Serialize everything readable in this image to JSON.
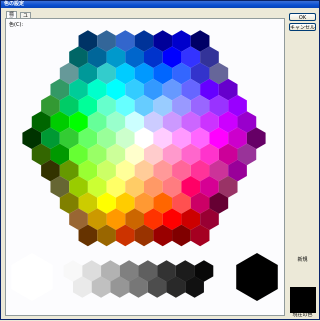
{
  "window": {
    "title": "色の設定"
  },
  "tabs": [
    {
      "label": "標準",
      "active": true
    },
    {
      "label": "ユーザー設定",
      "active": false
    }
  ],
  "panel": {
    "colors_label": "色(C):"
  },
  "buttons": {
    "ok": "OK",
    "cancel": "キャンセル"
  },
  "preview": {
    "new_label": "新規",
    "current_label": "現在の色",
    "new_color": "#000000",
    "current_color": "#000000"
  },
  "color_rows": [
    [
      "#003366",
      "#336699",
      "#3366CC",
      "#003399",
      "#000099",
      "#0000CC",
      "#000066"
    ],
    [
      "#006666",
      "#006699",
      "#0099CC",
      "#0066CC",
      "#0033CC",
      "#0000FF",
      "#3333FF",
      "#333399"
    ],
    [
      "#669999",
      "#009999",
      "#33CCCC",
      "#00CCFF",
      "#0099FF",
      "#0066FF",
      "#3366FF",
      "#3333CC",
      "#666699"
    ],
    [
      "#339966",
      "#00CC99",
      "#00FFCC",
      "#00FFFF",
      "#33CCFF",
      "#3399FF",
      "#6699FF",
      "#6666FF",
      "#6600FF",
      "#6600CC"
    ],
    [
      "#339933",
      "#00CC66",
      "#00FF99",
      "#66FFCC",
      "#66FFFF",
      "#66CCFF",
      "#99CCFF",
      "#9999FF",
      "#9966FF",
      "#9933FF",
      "#9900FF"
    ],
    [
      "#006600",
      "#00CC00",
      "#00FF00",
      "#66FF99",
      "#99FFCC",
      "#CCFFFF",
      "#CCCCFF",
      "#CC99FF",
      "#CC66FF",
      "#CC33FF",
      "#CC00FF",
      "#9900CC"
    ],
    [
      "#003300",
      "#009933",
      "#33CC33",
      "#66FF66",
      "#99FF99",
      "#CCFFCC",
      "#FFFFFF",
      "#FFCCFF",
      "#FF99FF",
      "#FF66FF",
      "#FF00FF",
      "#CC00CC",
      "#660066"
    ],
    [
      "#336600",
      "#009900",
      "#66FF33",
      "#99FF66",
      "#CCFF99",
      "#FFFFCC",
      "#FFCCCC",
      "#FF99CC",
      "#FF66CC",
      "#FF33CC",
      "#CC0099",
      "#993399"
    ],
    [
      "#333300",
      "#669900",
      "#99FF33",
      "#CCFF66",
      "#FFFF99",
      "#FFCC99",
      "#FF9999",
      "#FF6699",
      "#FF3399",
      "#CC3399",
      "#990099"
    ],
    [
      "#666633",
      "#99CC00",
      "#CCFF33",
      "#FFFF66",
      "#FFCC66",
      "#FF9966",
      "#FF7C80",
      "#FF0066",
      "#D60093",
      "#993366"
    ],
    [
      "#808000",
      "#CCCC00",
      "#FFFF00",
      "#FFCC00",
      "#FF9933",
      "#FF6600",
      "#FF5050",
      "#CC0066",
      "#660033"
    ],
    [
      "#996633",
      "#CC9900",
      "#FF9900",
      "#CC6600",
      "#FF3300",
      "#FF0000",
      "#CC0000",
      "#990033"
    ],
    [
      "#663300",
      "#996600",
      "#CC3300",
      "#993300",
      "#990000",
      "#800000",
      "#A50021"
    ]
  ],
  "gray_row": [
    "#F8F8F8",
    "#DDDDDD",
    "#B2B2B2",
    "#808080",
    "#5F5F5F",
    "#333333",
    "#1C1C1C",
    "#080808"
  ],
  "gray_row2": [
    "#EAEAEA",
    "#C0C0C0",
    "#969696",
    "#777777",
    "#4D4D4D",
    "#292929",
    "#111111"
  ],
  "big_white": "#FFFFFF",
  "big_black": "#000000"
}
